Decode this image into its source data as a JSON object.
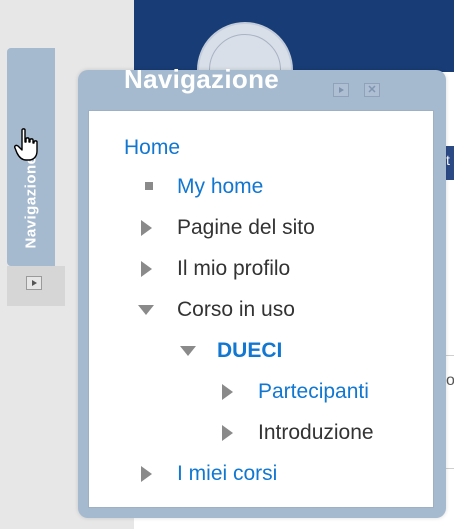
{
  "dock": {
    "tab_label": "Navigazione"
  },
  "block": {
    "title": "Navigazione"
  },
  "nav": {
    "home": "Home",
    "my_home": "My home",
    "site_pages": "Pagine del sito",
    "my_profile": "Il mio profilo",
    "current_course": "Corso in uso",
    "course_name": "DUECI",
    "participants": "Partecipanti",
    "introduction": "Introduzione",
    "my_courses": "I miei corsi"
  },
  "background": {
    "right_edge_glyph": "t",
    "lower_right_glyph": "o"
  },
  "colors": {
    "panel": "#a5b9cf",
    "link": "#1177d1",
    "banner": "#183d76"
  }
}
